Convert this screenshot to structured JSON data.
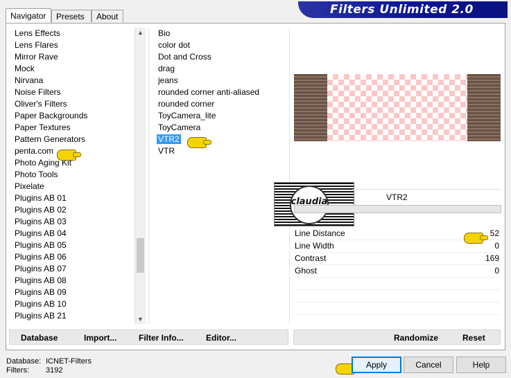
{
  "tabs": [
    {
      "label": "Navigator"
    },
    {
      "label": "Presets"
    },
    {
      "label": "About"
    }
  ],
  "title": "Filters Unlimited 2.0",
  "categories": [
    "Lens Effects",
    "Lens Flares",
    "Mirror Rave",
    "Mock",
    "Nirvana",
    "Noise Filters",
    "Oliver's Filters",
    "Paper Backgrounds",
    "Paper Textures",
    "Pattern Generators",
    "penta.com",
    "Photo Aging Kit",
    "Photo Tools",
    "Pixelate",
    "Plugins AB 01",
    "Plugins AB 02",
    "Plugins AB 03",
    "Plugins AB 04",
    "Plugins AB 05",
    "Plugins AB 06",
    "Plugins AB 07",
    "Plugins AB 08",
    "Plugins AB 09",
    "Plugins AB 10",
    "Plugins AB 21"
  ],
  "filters": [
    "Bio",
    "color dot",
    "Dot and Cross",
    "drag",
    "jeans",
    "rounded corner anti-aliased",
    "rounded corner",
    "ToyCamera_lite",
    "ToyCamera",
    "VTR2",
    "VTR"
  ],
  "selected_filter": "VTR2",
  "stamp_text": "claudia",
  "params_title": "VTR2",
  "params": [
    {
      "label": "Line Distance",
      "value": "52"
    },
    {
      "label": "Line Width",
      "value": "0"
    },
    {
      "label": "Contrast",
      "value": "169"
    },
    {
      "label": "Ghost",
      "value": "0"
    }
  ],
  "toolbar": {
    "database": "Database",
    "import": "Import...",
    "filter_info": "Filter Info...",
    "editor": "Editor...",
    "randomize": "Randomize",
    "reset": "Reset"
  },
  "status": {
    "database_label": "Database:",
    "database_value": "ICNET-Filters",
    "filters_label": "Filters:",
    "filters_value": "3192"
  },
  "buttons": {
    "apply": "Apply",
    "cancel": "Cancel",
    "help": "Help"
  },
  "colors": {
    "title_bar": "#0a1490",
    "selection": "#3399ff",
    "checker": "#fbc7c7"
  }
}
